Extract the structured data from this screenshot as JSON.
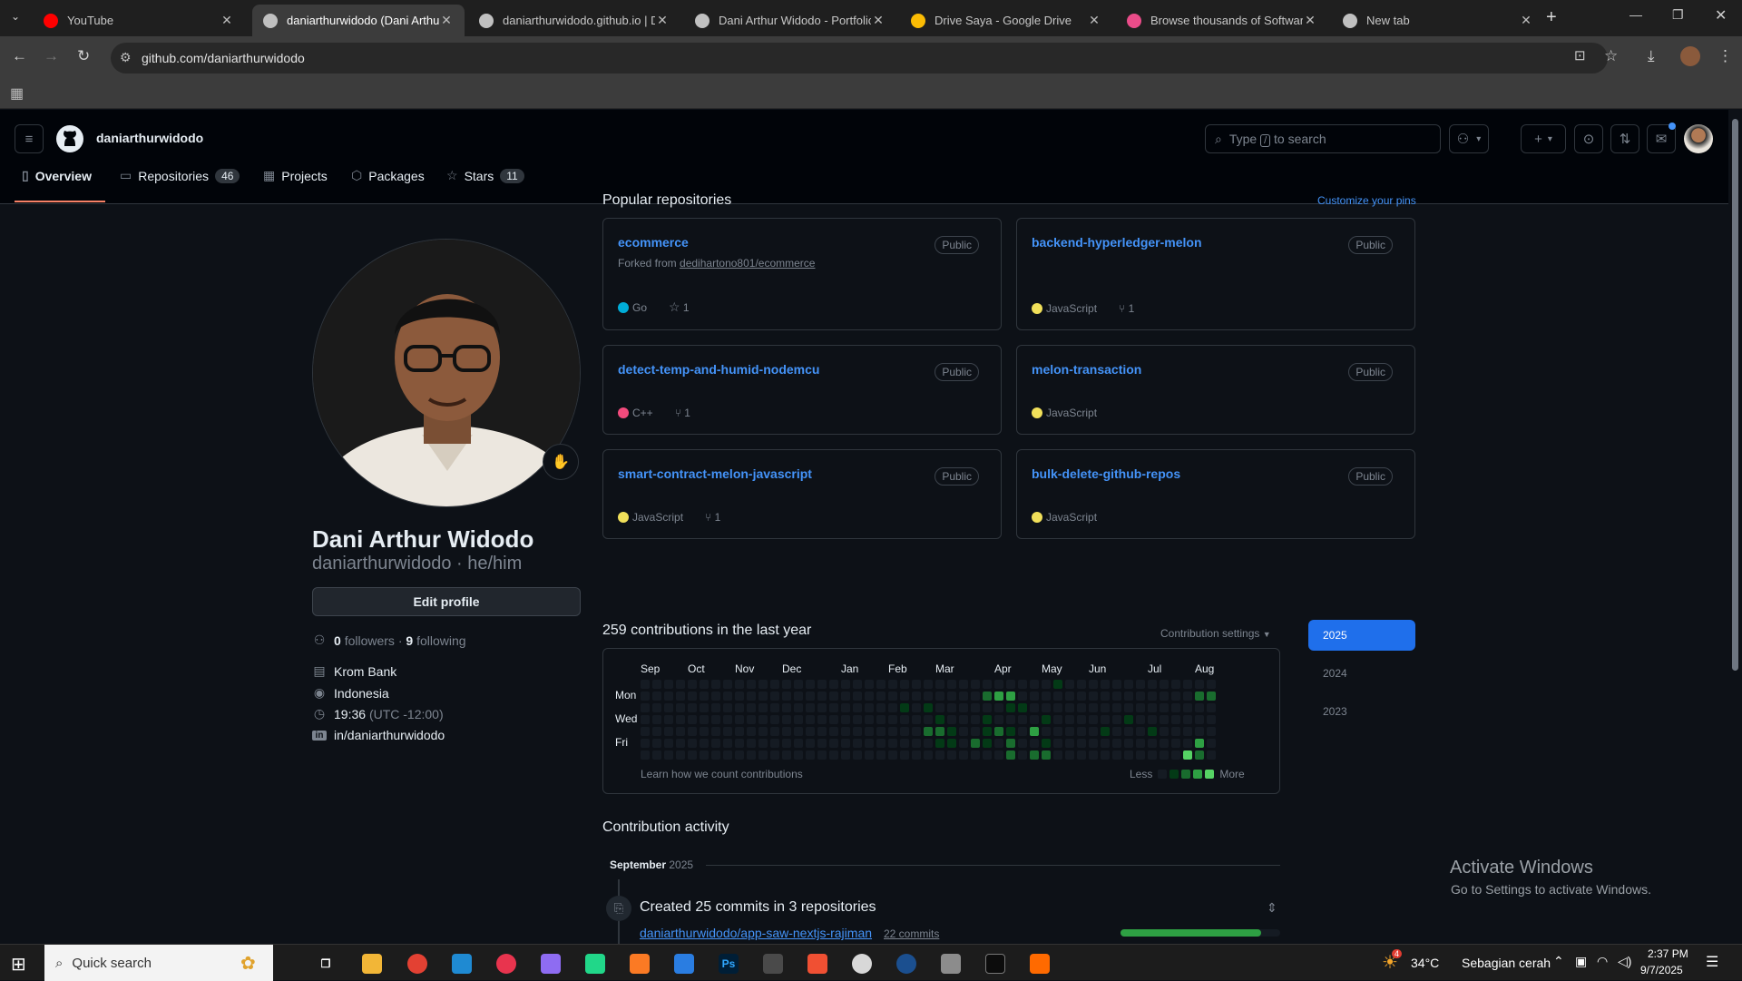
{
  "browser": {
    "tabs": [
      {
        "title": "YouTube",
        "color": "#ff0000"
      },
      {
        "title": "daniarthurwidodo (Dani Arthur",
        "color": "#c0c0c0"
      },
      {
        "title": "daniarthurwidodo.github.io | Da",
        "color": "#c0c0c0"
      },
      {
        "title": "Dani Arthur Widodo - Portfolio",
        "color": "#c0c0c0"
      },
      {
        "title": "Drive Saya - Google Drive",
        "color": "#fbbc04"
      },
      {
        "title": "Browse thousands of Software I",
        "color": "#ea4c89"
      },
      {
        "title": "New tab",
        "color": "#c0c0c0"
      }
    ],
    "new_tab": "+",
    "url": "github.com/daniarthurwidodo"
  },
  "github": {
    "username": "daniarthurwidodo",
    "search_placeholder": "Type / to search",
    "search_key": "/",
    "nav": {
      "overview": "Overview",
      "repositories": "Repositories",
      "repositories_count": "46",
      "projects": "Projects",
      "packages": "Packages",
      "stars": "Stars",
      "stars_count": "11"
    },
    "profile": {
      "name": "Dani Arthur Widodo",
      "login_line": "daniarthurwidodo · he/him",
      "edit": "Edit profile",
      "followers_num": "0",
      "followers_label": "followers",
      "sep": "·",
      "following_num": "9",
      "following_label": "following",
      "company": "Krom Bank",
      "location": "Indonesia",
      "time": "19:36",
      "tz": "(UTC -12:00)",
      "linkedin": "in/daniarthurwidodo"
    },
    "pins": {
      "title": "Popular repositories",
      "customize": "Customize your pins",
      "public_label": "Public",
      "forked_prefix": "Forked from",
      "forked_repo": "dedihartono801/ecommerce",
      "items": [
        {
          "name": "ecommerce",
          "lang": "Go",
          "color": "#00add8",
          "stars": "1"
        },
        {
          "name": "backend-hyperledger-melon",
          "lang": "JavaScript",
          "color": "#f1e05a",
          "forks": "1"
        },
        {
          "name": "detect-temp-and-humid-nodemcu",
          "lang": "C++",
          "color": "#f34b7d",
          "forks": "1"
        },
        {
          "name": "melon-transaction",
          "lang": "JavaScript",
          "color": "#f1e05a"
        },
        {
          "name": "smart-contract-melon-javascript",
          "lang": "JavaScript",
          "color": "#f1e05a",
          "forks": "1"
        },
        {
          "name": "bulk-delete-github-repos",
          "lang": "JavaScript",
          "color": "#f1e05a"
        }
      ]
    },
    "contrib": {
      "title": "259 contributions in the last year",
      "settings": "Contribution settings",
      "months": [
        "Sep",
        "Oct",
        "Nov",
        "Dec",
        "Jan",
        "Feb",
        "Mar",
        "Apr",
        "May",
        "Jun",
        "Jul",
        "Aug"
      ],
      "days": [
        "Mon",
        "Wed",
        "Fri"
      ],
      "learn": "Learn how we count contributions",
      "less": "Less",
      "more": "More",
      "years": [
        "2025",
        "2024",
        "2023"
      ]
    },
    "activity": {
      "title": "Contribution activity",
      "month": "September",
      "year": "2025",
      "summary": "Created 25 commits in 3 repositories",
      "repo": "daniarthurwidodo/app-saw-nextjs-rajiman",
      "commits": "22 commits",
      "progress": 0.88
    },
    "watermark": {
      "title": "Activate Windows",
      "subtitle": "Go to Settings to activate Windows."
    }
  },
  "taskbar": {
    "search": "Quick search",
    "temp": "34°C",
    "weather": "Sebagian cerah",
    "time": "2:37 PM",
    "date": "9/7/2025",
    "notif_count": "4"
  }
}
